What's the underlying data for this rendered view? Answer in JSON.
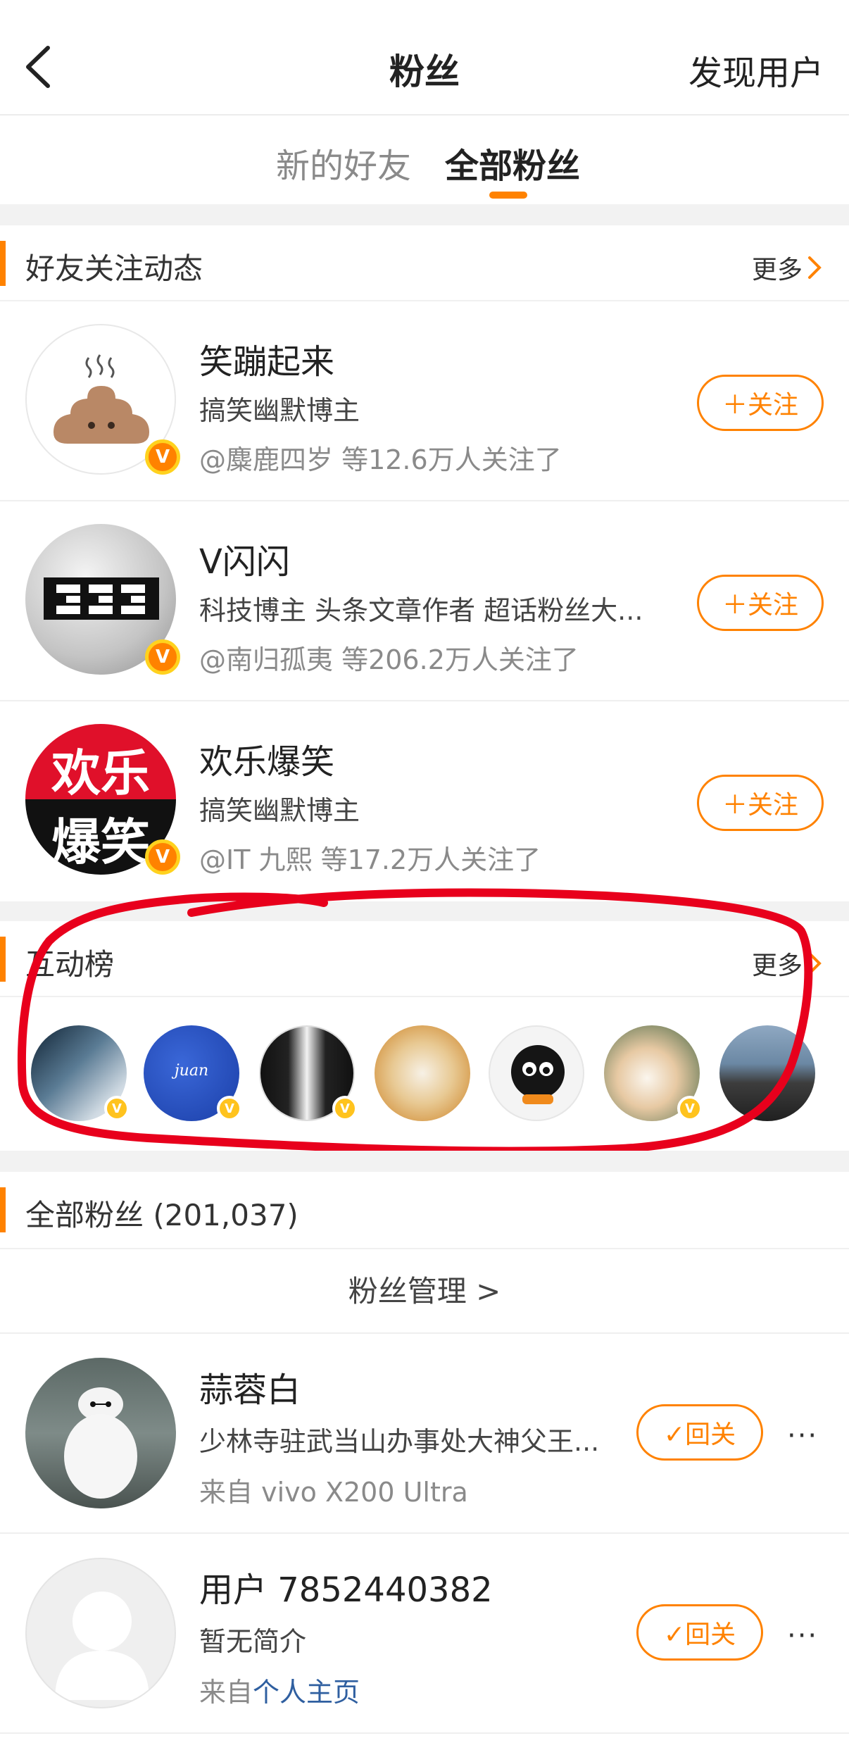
{
  "header": {
    "title": "粉丝",
    "discover_label": "发现用户"
  },
  "tabs": [
    {
      "label": "新的好友",
      "active": false
    },
    {
      "label": "全部粉丝",
      "active": true
    }
  ],
  "friend_follow": {
    "section_title": "好友关注动态",
    "more_label": "更多",
    "items": [
      {
        "name": "笑蹦起来",
        "desc": "搞笑幽默博主",
        "via": "@麋鹿四岁 等12.6万人关注了",
        "button": "＋关注",
        "avatar": "poop-emoji-avatar"
      },
      {
        "name": "V闪闪",
        "desc": "科技博主 头条文章作者 超话粉丝大...",
        "via": "@南归孤夷 等206.2万人关注了",
        "button": "＋关注",
        "avatar": "33-logo-avatar"
      },
      {
        "name": "欢乐爆笑",
        "desc": "搞笑幽默博主",
        "via": "@IT 九熙 等17.2万人关注了",
        "button": "＋关注",
        "avatar": "huanle-baoxiao-avatar",
        "avatar_text": [
          "欢乐",
          "爆笑"
        ]
      }
    ]
  },
  "interaction_rank": {
    "section_title": "互动榜",
    "more_label": "更多",
    "avatar_count": 7
  },
  "all_fans": {
    "section_title": "全部粉丝 (201,037)",
    "manage_label": "粉丝管理  >",
    "items": [
      {
        "name": "蒜蓉白",
        "desc": "少林寺驻武当山办事处大神父王...",
        "from_prefix": "来自 vivo X200 Ultra",
        "from_link": "",
        "button": "✓回关",
        "more": "···"
      },
      {
        "name": "用户 7852440382",
        "desc": "暂无简介",
        "from_prefix": "来自",
        "from_link": "个人主页",
        "button": "✓回关",
        "more": "···"
      }
    ]
  },
  "colors": {
    "accent": "#ff8200",
    "annotation": "#e8001c",
    "link": "#2f5fa0"
  }
}
